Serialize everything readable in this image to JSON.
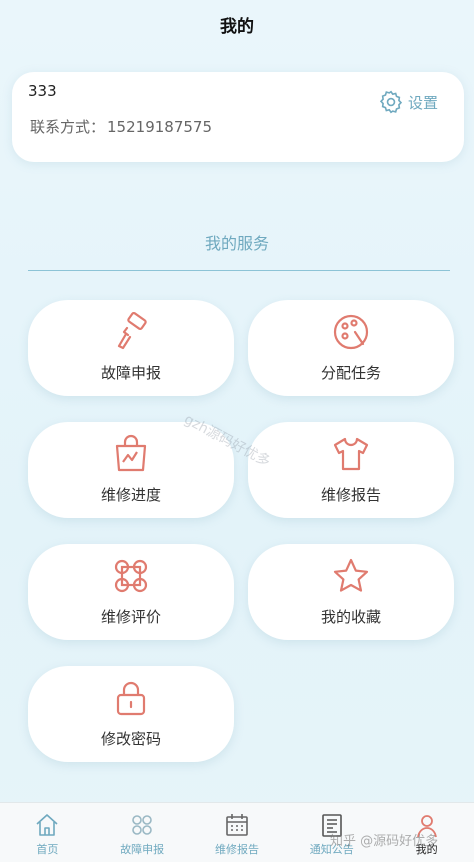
{
  "header": {
    "title": "我的"
  },
  "profile": {
    "name": "333",
    "contact_label": "联系方式：",
    "contact_value": "15219187575",
    "settings_label": "设置"
  },
  "services": {
    "title": "我的服务",
    "items": [
      {
        "label": "故障申报",
        "icon": "paint-roller-icon"
      },
      {
        "label": "分配任务",
        "icon": "palette-icon"
      },
      {
        "label": "维修进度",
        "icon": "shopping-bag-icon"
      },
      {
        "label": "维修报告",
        "icon": "tshirt-icon"
      },
      {
        "label": "维修评价",
        "icon": "grid-circles-icon"
      },
      {
        "label": "我的收藏",
        "icon": "star-icon"
      },
      {
        "label": "修改密码",
        "icon": "lock-icon"
      }
    ]
  },
  "watermark": "gzh源码好优多",
  "tabbar": {
    "items": [
      {
        "label": "首页",
        "icon": "home-icon"
      },
      {
        "label": "故障申报",
        "icon": "grid-icon"
      },
      {
        "label": "维修报告",
        "icon": "calendar-icon"
      },
      {
        "label": "通知公告",
        "icon": "newspaper-icon"
      },
      {
        "label": "我的",
        "icon": "user-icon"
      }
    ]
  },
  "overlay_text": "知乎 @源码好优多",
  "colors": {
    "accent": "#6fa9bf",
    "icon": "#e07b6f"
  }
}
